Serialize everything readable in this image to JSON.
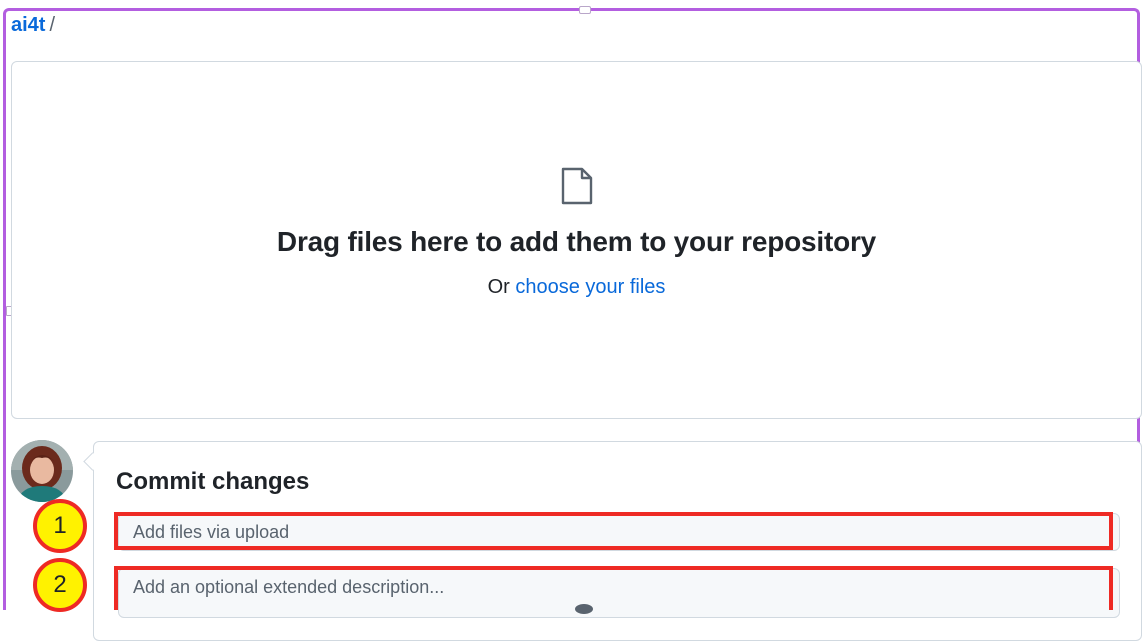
{
  "breadcrumb": {
    "owner": "ai4t",
    "separator": "/"
  },
  "dropzone": {
    "icon": "file-icon",
    "title": "Drag files here to add them to your repository",
    "subtitle_prefix": "Or",
    "choose_link": "choose your files"
  },
  "commit": {
    "title": "Commit changes",
    "summary_placeholder": "Add files via upload",
    "description_placeholder": "Add an optional extended description..."
  },
  "annotations": [
    {
      "label": "1"
    },
    {
      "label": "2"
    }
  ],
  "colors": {
    "link": "#0969da",
    "frame": "#b35ee0",
    "annotation_border": "#ee2a24",
    "annotation_fill": "#fff200"
  }
}
